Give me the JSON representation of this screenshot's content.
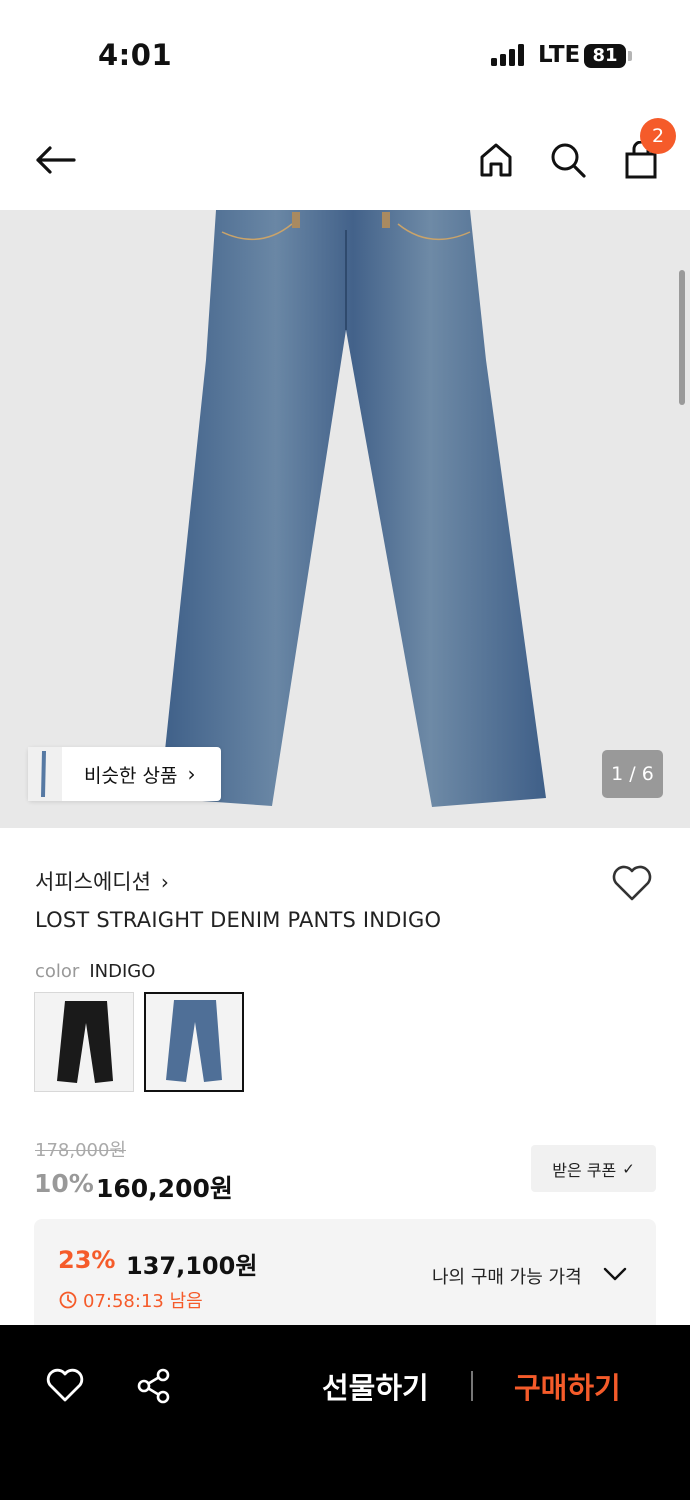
{
  "status_bar": {
    "time": "4:01",
    "network": "LTE",
    "battery": "81"
  },
  "header": {
    "back_icon": "arrow-left-icon",
    "home_icon": "home-icon",
    "search_icon": "search-icon",
    "cart_icon": "shopping-bag-icon",
    "cart_count": "2"
  },
  "gallery": {
    "similar_label": "비슷한 상품",
    "similar_arrow": "›",
    "counter": "1 / 6"
  },
  "product": {
    "brand": "서피스에디션",
    "brand_arrow": "›",
    "name": "LOST STRAIGHT DENIM PANTS INDIGO",
    "color_key": "color",
    "color_value": "INDIGO"
  },
  "price": {
    "original": "178,000원",
    "discount_rate": "10%",
    "sale_price": "160,200원",
    "coupon_label": "받은 쿠폰",
    "coupon_check": "✓"
  },
  "my_price": {
    "discount_rate": "23%",
    "price": "137,100원",
    "timer": "07:58:13 남음",
    "label": "나의 구매 가능 가격"
  },
  "bottom_bar": {
    "gift_label": "선물하기",
    "buy_label": "구매하기"
  },
  "colors": {
    "accent": "#f55b2a",
    "denim": "#44638c",
    "black": "#1a1a1a"
  }
}
